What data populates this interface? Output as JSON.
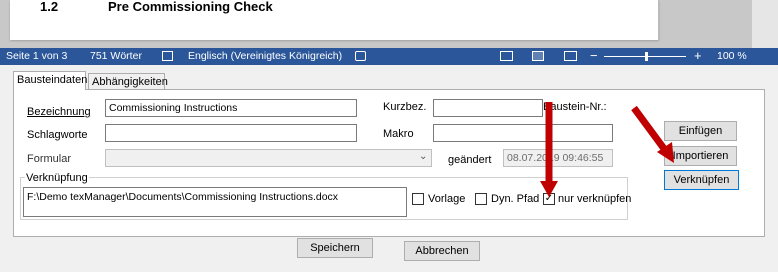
{
  "document": {
    "heading_number": "1.2",
    "heading_text": "Pre Commissioning Check"
  },
  "statusbar": {
    "page": "Seite 1 von 3",
    "words": "751 Wörter",
    "language": "Englisch (Vereinigtes Königreich)",
    "zoom_minus": "−",
    "zoom_plus": "+",
    "zoom": "100 %"
  },
  "tabs": [
    {
      "label": "Bausteindaten"
    },
    {
      "label": "Abhängigkeiten"
    }
  ],
  "form": {
    "bezeichnung_label": "Bezeichnung",
    "bezeichnung_value": "Commissioning Instructions",
    "schlagworte_label": "Schlagworte",
    "schlagworte_value": "",
    "formular_label": "Formular",
    "formular_value": "",
    "kurzbez_label": "Kurzbez.",
    "kurzbez_value": "",
    "baustein_nr_label": "Baustein-Nr.:",
    "makro_label": "Makro",
    "makro_value": "",
    "geaendert_label": "geändert",
    "geaendert_value": "08.07.2019 09:46:55"
  },
  "verknuepfung": {
    "label": "Verknüpfung",
    "path": "F:\\Demo texManager\\Documents\\Commissioning Instructions.docx",
    "vorlage_label": "Vorlage",
    "vorlage_checked": false,
    "dyn_pfad_label": "Dyn. Pfad",
    "dyn_pfad_checked": false,
    "nur_verknuepfen_label": "nur verknüpfen",
    "nur_verknuepfen_checked": true
  },
  "buttons": {
    "einfuegen": "Einfügen",
    "importieren": "Importieren",
    "verknuepfen": "Verknüpfen",
    "speichern": "Speichern",
    "abbrechen": "Abbrechen"
  },
  "colors": {
    "statusbar": "#2b579a",
    "arrow": "#c00000",
    "focus": "#0078d7"
  }
}
